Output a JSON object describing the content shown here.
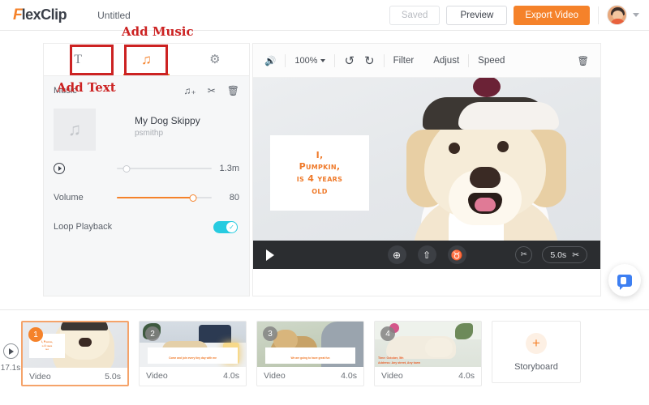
{
  "app": {
    "brand_prefix": "F",
    "brand_rest": "lexClip",
    "doc_title": "Untitled",
    "accent_color": "#f5822a",
    "annotation_color": "#cc2222",
    "toggle_color": "#27cbe0"
  },
  "topbar": {
    "saved_label": "Saved",
    "preview_label": "Preview",
    "export_label": "Export Video",
    "avatar_name": "avatar",
    "caret_icon": "chevron-down-icon"
  },
  "annotations": [
    {
      "id": "add-music",
      "text": "Add Music"
    },
    {
      "id": "add-text",
      "text": "Add Text"
    }
  ],
  "left_panel": {
    "tabs": [
      {
        "id": "text",
        "icon": "text-tab-icon",
        "glyph": "T",
        "active": false
      },
      {
        "id": "music",
        "icon": "music-note-icon",
        "glyph": "♫",
        "active": true
      },
      {
        "id": "settings",
        "icon": "gear-icon",
        "glyph": "⚙",
        "active": false
      }
    ],
    "section_title": "Music",
    "header_icons": [
      {
        "name": "add-music-icon",
        "glyph": "♫₊"
      },
      {
        "name": "split-icon",
        "glyph": "✂"
      },
      {
        "name": "delete-icon",
        "glyph": "🗑"
      }
    ],
    "track": {
      "thumb_icon": "music-note-icon",
      "thumb_glyph": "♫",
      "title": "My Dog Skippy",
      "artist": "psmithp"
    },
    "position": {
      "play_icon": "play-icon",
      "value_label": "1.3m",
      "percent": 10
    },
    "volume": {
      "label": "Volume",
      "value_label": "80",
      "percent": 80
    },
    "loop": {
      "label": "Loop Playback",
      "enabled": true,
      "check_glyph": "✓"
    }
  },
  "preview": {
    "toolbar": {
      "volume_icon": "speaker-icon",
      "volume_glyph": "🔊",
      "zoom_value": "100%",
      "undo_icon": "undo-icon",
      "undo_glyph": "↺",
      "redo_icon": "redo-icon",
      "redo_glyph": "↻",
      "filter_label": "Filter",
      "adjust_label": "Adjust",
      "speed_label": "Speed",
      "trash_icon": "trash-icon",
      "trash_glyph": "🗑"
    },
    "overlay_lines": [
      "I,",
      "Pumpkin,",
      "is 4 years",
      "old"
    ],
    "overlay_text_color": "#ef7a2a",
    "player": {
      "play_icon": "play-icon",
      "globe_icon": "globe-icon",
      "globe_glyph": "⊕",
      "upload_icon": "upload-icon",
      "upload_glyph": "⇧",
      "mic_icon": "microphone-icon",
      "mic_glyph": "♉",
      "split_icon": "split-icon",
      "split_glyph": "✂",
      "duration_label": "5.0s",
      "scissors_glyph": "✂"
    }
  },
  "timeline": {
    "play_icon": "play-icon",
    "total_duration": "17.1s",
    "clips": [
      {
        "index": "1",
        "type_label": "Video",
        "duration": "5.0s",
        "selected": true,
        "caption_lines": [
          "I, Pumpkin,",
          "is 4 years",
          "old"
        ]
      },
      {
        "index": "2",
        "type_label": "Video",
        "duration": "4.0s",
        "selected": false,
        "caption_lines": [
          "Come and join every tiny day with me"
        ]
      },
      {
        "index": "3",
        "type_label": "Video",
        "duration": "4.0s",
        "selected": false,
        "caption_lines": [
          "We are going to have great fun"
        ]
      },
      {
        "index": "4",
        "type_label": "Video",
        "duration": "4.0s",
        "selected": false,
        "caption_lines": [
          "Time: October, 5th",
          "Address: Any street, Any town"
        ]
      }
    ],
    "storyboard": {
      "label": "Storyboard",
      "plus_icon": "plus-icon",
      "plus_glyph": "+"
    }
  },
  "chat": {
    "icon": "chat-bubble-icon"
  }
}
